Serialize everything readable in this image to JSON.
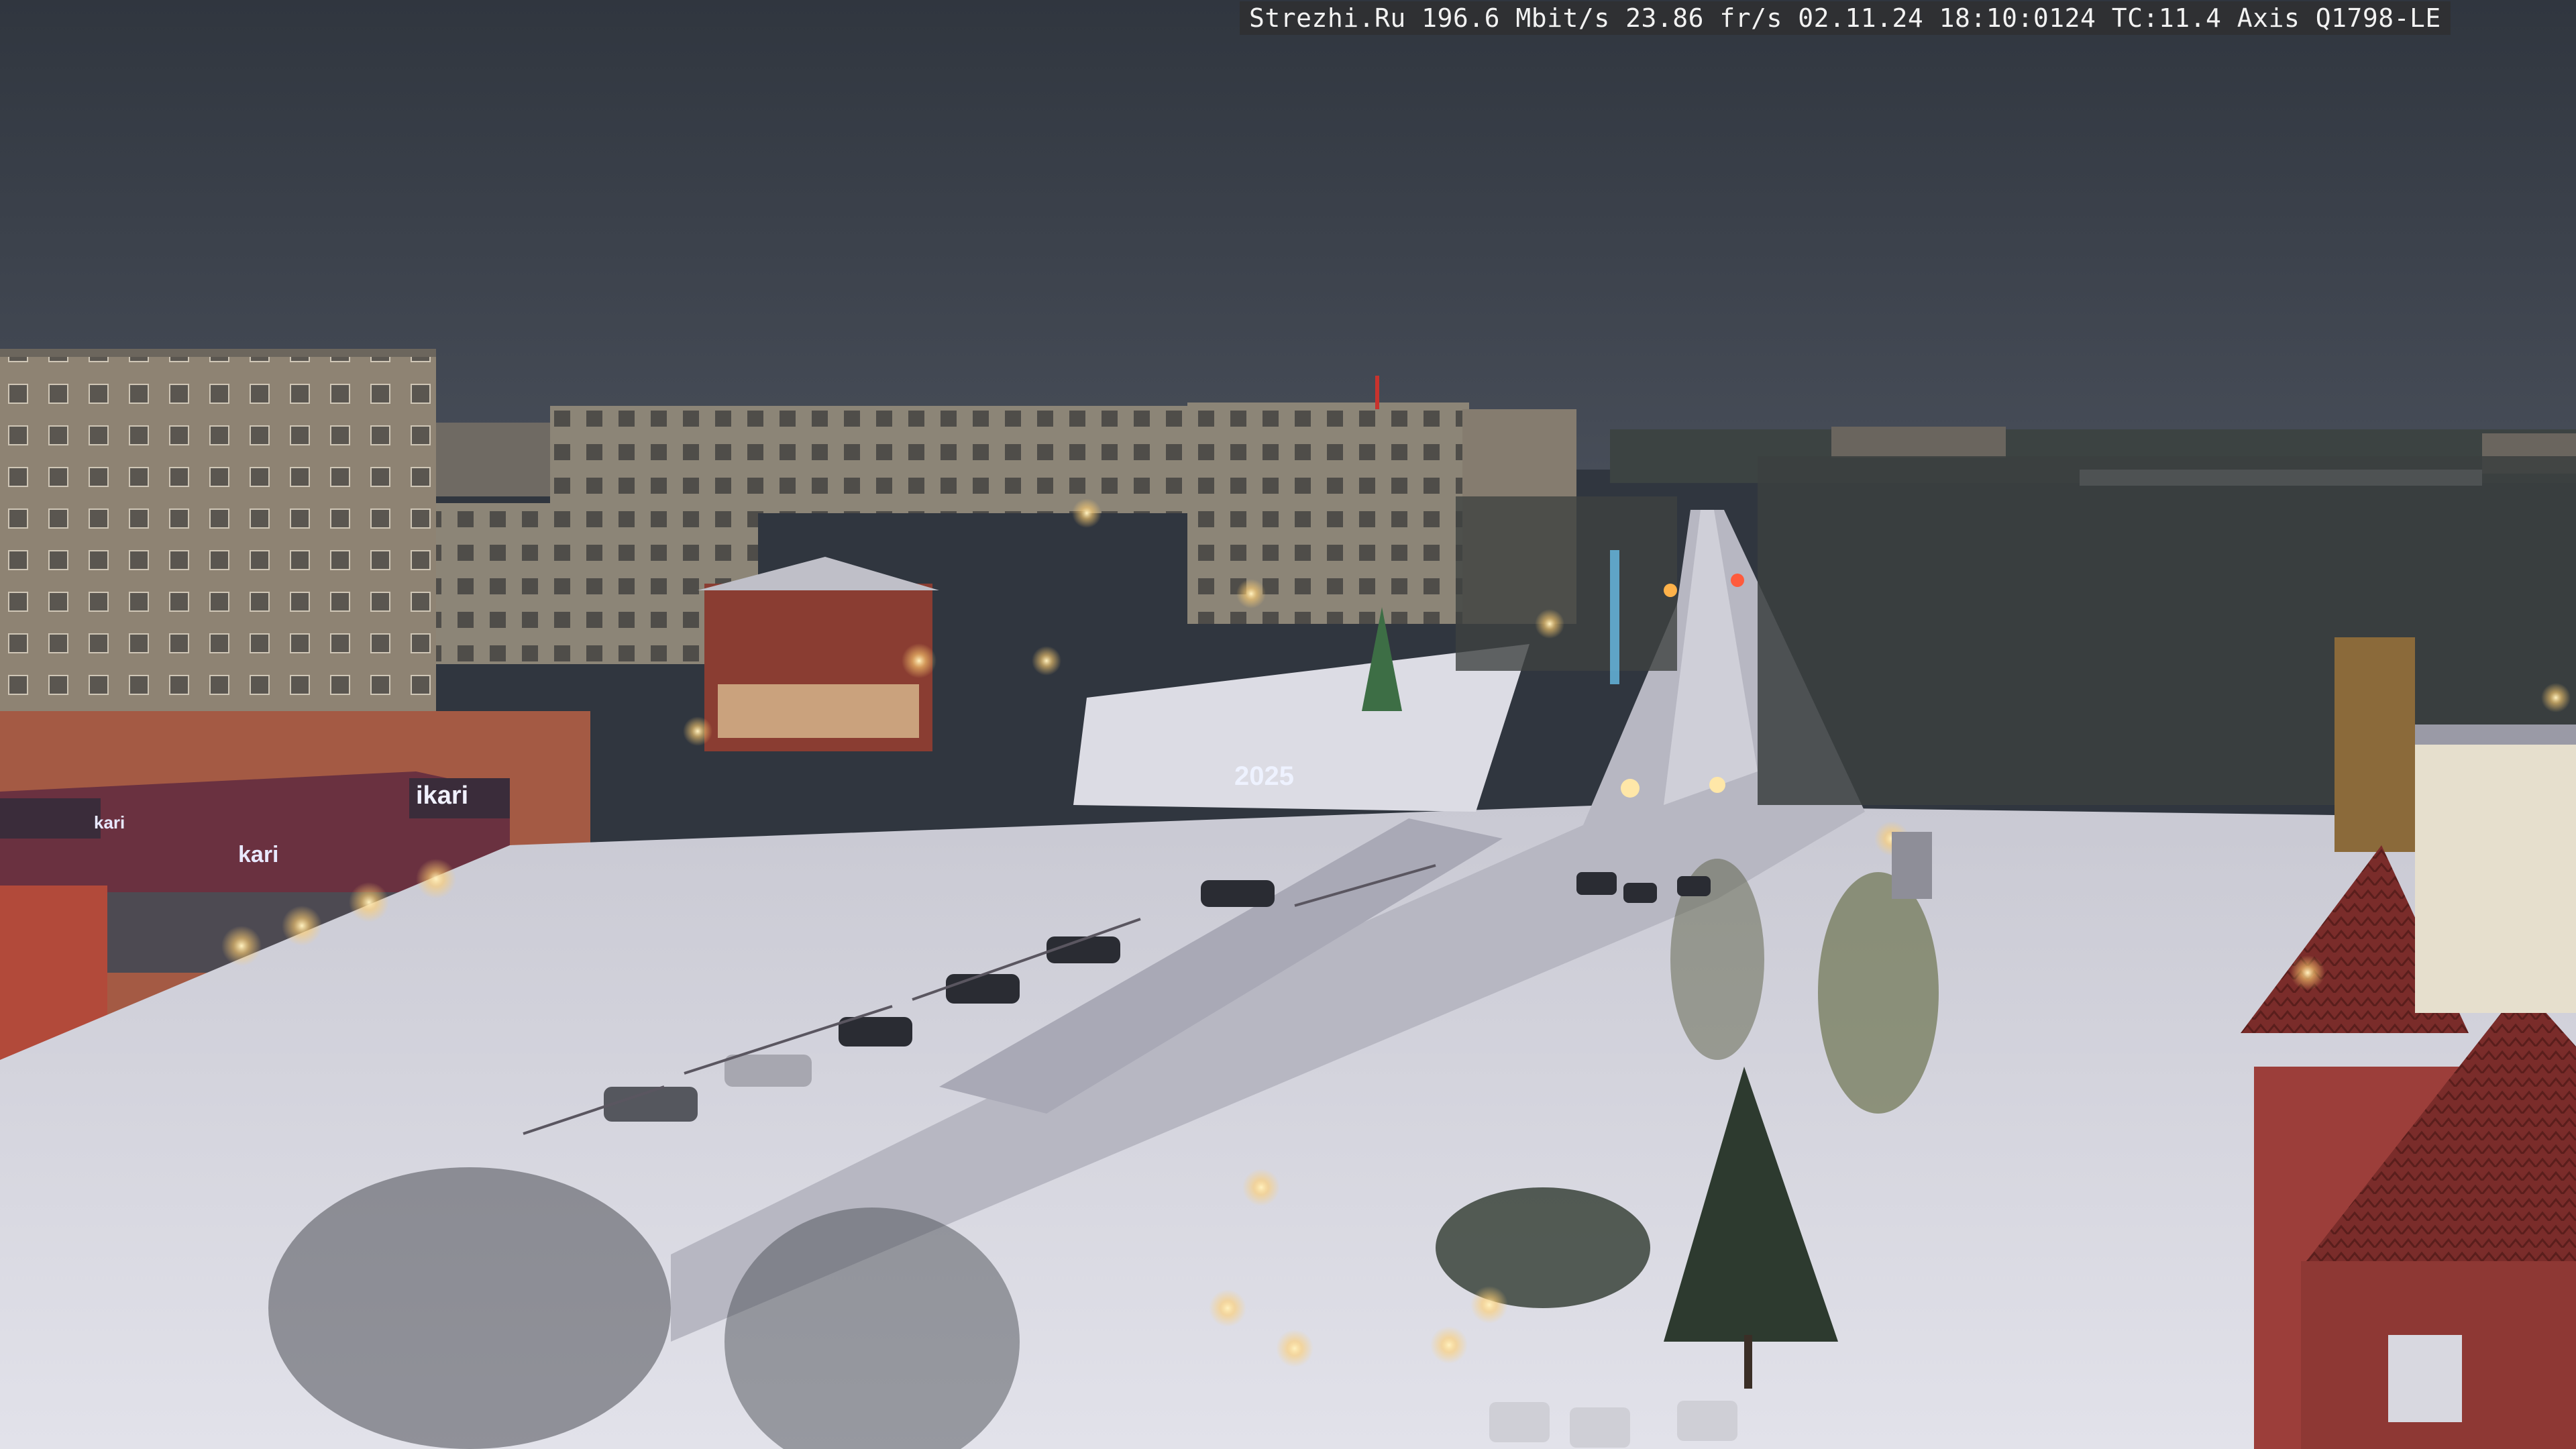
{
  "overlay": {
    "text": "Strezhi.Ru 196.6 Mbit/s 23.86 fr/s 02.11.24 18:10:0124 TC:11.4  Axis Q1798-LE"
  },
  "signs": {
    "store_main": "ikari",
    "store_secondary": "kari",
    "store_tertiary": "kari",
    "holiday_year": "2025"
  },
  "colors": {
    "sky": "#363c47",
    "snow": "#d8d8e0",
    "road": "#bdbdc8",
    "streetlight": "#ffd27a",
    "building_brick": "#a0503a",
    "building_panel": "#9c8f7e",
    "store_sign": "#e8e8ff"
  }
}
